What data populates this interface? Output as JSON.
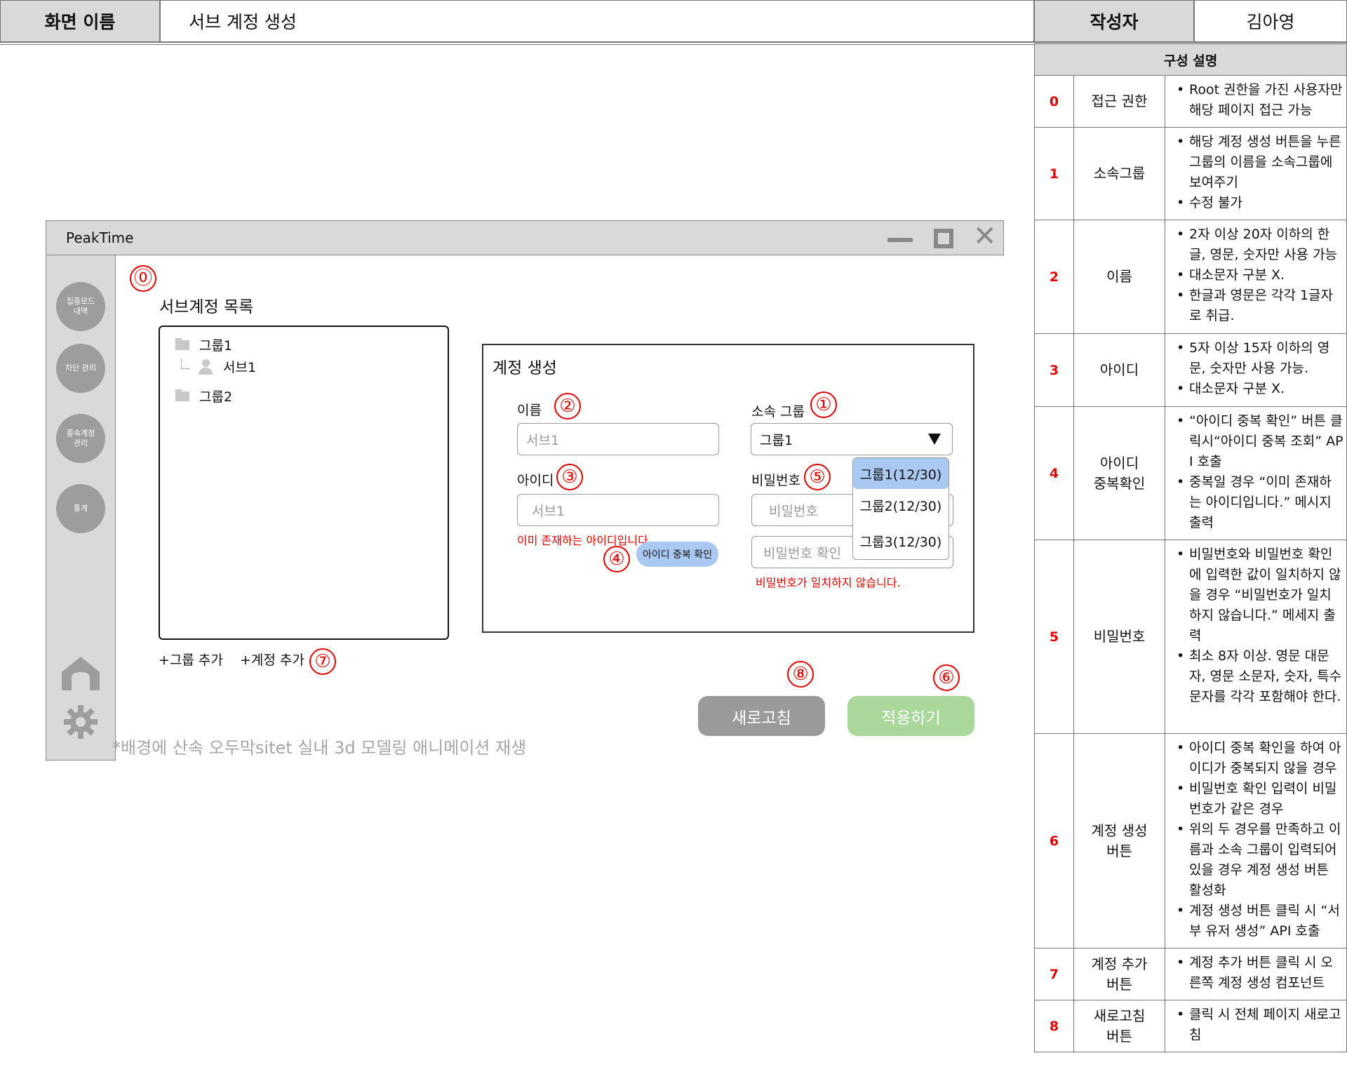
{
  "header": {
    "screen_label": "화면 이름",
    "screen_value": "서브 계정 생성",
    "author_label": "작성자",
    "author_value": "김아영"
  },
  "window": {
    "title": "PeakTime"
  },
  "sidebar": {
    "items": [
      {
        "label": "집중모드\n내역"
      },
      {
        "label": "차단 관리"
      },
      {
        "label": "종속계정\n관리"
      },
      {
        "label": "통계"
      }
    ]
  },
  "tree": {
    "title": "서브계정 목록",
    "nodes": [
      {
        "label": "그룹1"
      },
      {
        "label": "서브1"
      },
      {
        "label": "그룹2"
      }
    ],
    "add_group_label": "+그룹 추가",
    "add_account_label": "+계정 추가"
  },
  "form": {
    "title": "계정 생성",
    "name_label": "이름",
    "name_placeholder": "서브1",
    "group_label": "소속 그룹",
    "group_value": "그룹1",
    "id_label": "아이디",
    "id_placeholder": "서브1",
    "id_error": "이미 존재하는 아이디입니다",
    "dup_check_label": "아이디 중복 확인",
    "password_label": "비밀번호",
    "password_placeholder": "비밀번호",
    "password_confirm_placeholder": "비밀번호 확인",
    "password_error": "비밀번호가 일치하지 않습니다.",
    "group_options": [
      "그룹1(12/30)",
      "그룹2(12/30)",
      "그룹3(12/30)"
    ],
    "selected_group_index": 0
  },
  "buttons": {
    "refresh_label": "새로고침",
    "apply_label": "적용하기"
  },
  "note": "*배경에 산속 오두막sitet 실내 3d 모델링 애니메이션 재생",
  "markers": [
    "⓪",
    "①",
    "②",
    "③",
    "④",
    "⑤",
    "⑥",
    "⑦",
    "⑧"
  ],
  "description": {
    "title": "구성 설명",
    "rows": [
      {
        "num": "0",
        "name": "접근 권한",
        "items": [
          "Root 권한을 가진 사용자만 해당 페이지 접근 가능"
        ]
      },
      {
        "num": "1",
        "name": "소속그룹",
        "items": [
          "해당 계정 생성 버튼을 누른 그룹의 이름을 소속그룹에 보여주기",
          "수정 불가"
        ]
      },
      {
        "num": "2",
        "name": "이름",
        "items": [
          "2자 이상 20자 이하의 한글, 영문, 숫자만 사용 가능",
          "대소문자 구분 X.",
          "한글과 영문은 각각 1글자로 취급."
        ]
      },
      {
        "num": "3",
        "name": "아이디",
        "items": [
          "5자 이상 15자 이하의 영문, 숫자만 사용 가능.",
          "대소문자 구분 X."
        ]
      },
      {
        "num": "4",
        "name": "아이디\n중복확인",
        "items": [
          "“아이디 중복 확인” 버튼 클릭시“아이디 중복 조회” API 호출",
          "중복일 경우 “이미 존재하는 아이디입니다.” 메시지 출력"
        ]
      },
      {
        "num": "5",
        "name": "비밀번호",
        "items": [
          "비밀번호와 비밀번호 확인에 입력한 값이 일치하지 않을 경우 “비밀번호가 일치하지 않습니다.” 메세지 출력",
          "최소 8자 이상. 영문 대문자, 영문 소문자, 숫자, 특수문자를 각각 포함해야 한다."
        ]
      },
      {
        "num": "6",
        "name": "계정 생성\n버튼",
        "items": [
          "아이디 중복 확인을 하여 아이디가 중복되지 않을 경우",
          "비밀번호 확인 입력이 비밀번호가 같은 경우",
          "위의 두 경우를 만족하고 이름과 소속 그룹이 입력되어 있을 경우 계정 생성 버튼 활성화",
          "계정 생성 버튼 클릭 시 “서부 유저 생성” API 호출"
        ]
      },
      {
        "num": "7",
        "name": "계정 추가\n버튼",
        "items": [
          "계정 추가 버튼 클릭 시 오른쪽 계정 생성 컴포넌트"
        ]
      },
      {
        "num": "8",
        "name": "새로고침\n버튼",
        "items": [
          "클릭 시 전체 페이지 새로고침"
        ]
      }
    ]
  }
}
